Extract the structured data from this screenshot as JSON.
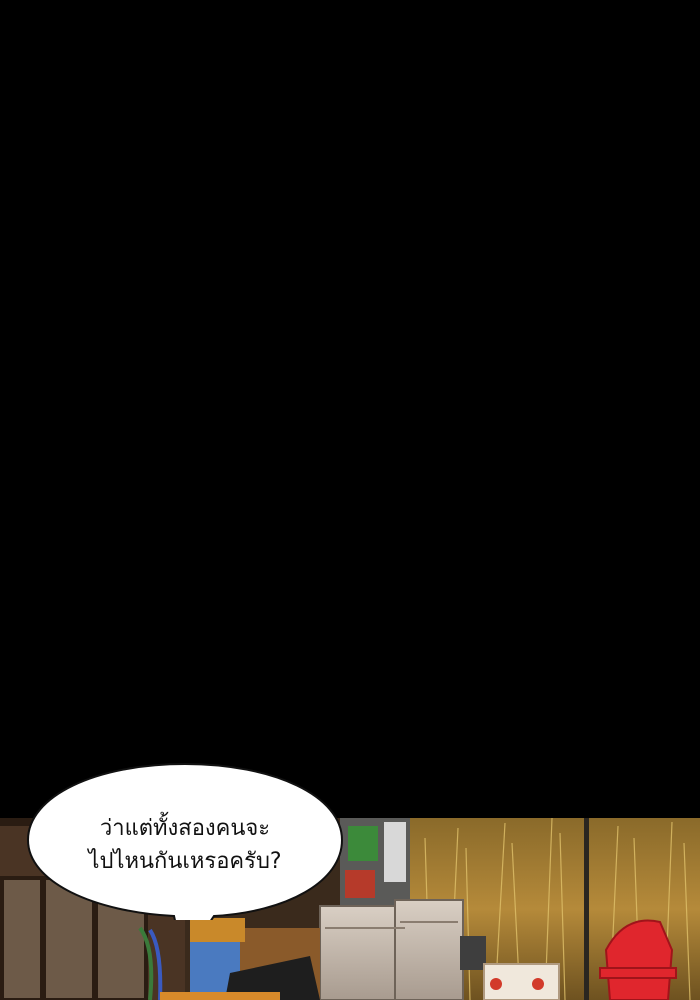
{
  "speech_bubble": {
    "lines": [
      "ว่าแต่ทั้งสองคนจะ",
      "ไปไหนกันเหรอครับ?"
    ]
  },
  "colors": {
    "background": "#000000",
    "bubble_fill": "#ffffff",
    "grass": "#b58a3a",
    "chair": "#e0262d"
  }
}
